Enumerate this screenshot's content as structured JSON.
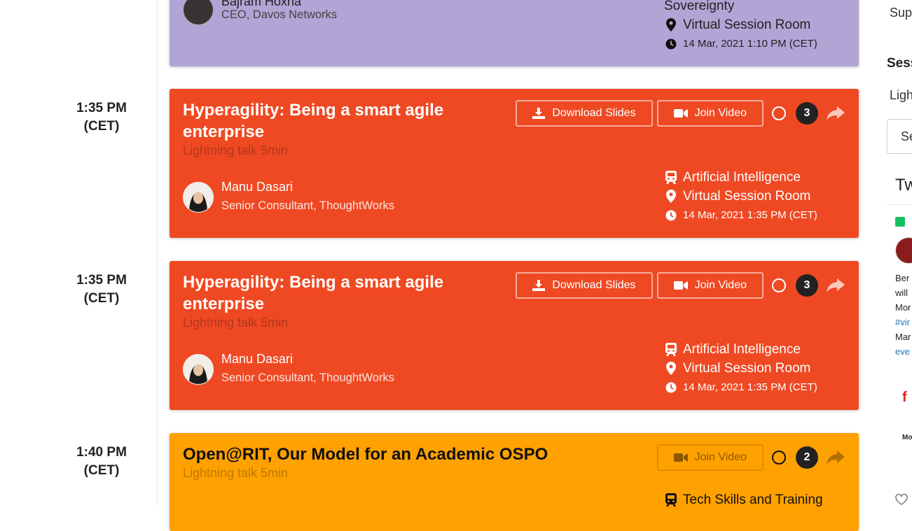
{
  "sessions": [
    {
      "time": "",
      "tz": "",
      "title": "",
      "subtitle": "",
      "speaker_name": "Bajram Hoxha",
      "speaker_role": "CEO, Davos Networks",
      "track": "Sovereignty",
      "room": "Virtual Session Room",
      "datetime": "14 Mar, 2021 1:10 PM (CET)"
    },
    {
      "time": "1:35 PM",
      "tz": "(CET)",
      "title": "Hyperagility: Being a smart agile enterprise",
      "subtitle": "Lightning talk 5min",
      "download_label": "Download Slides",
      "join_label": "Join Video",
      "count": "3",
      "speaker_name": "Manu Dasari",
      "speaker_role": "Senior Consultant, ThoughtWorks",
      "track": "Artificial Intelligence",
      "room": "Virtual Session Room",
      "datetime": "14 Mar, 2021 1:35 PM (CET)"
    },
    {
      "time": "1:35 PM",
      "tz": "(CET)",
      "title": "Hyperagility: Being a smart agile enterprise",
      "subtitle": "Lightning talk 5min",
      "download_label": "Download Slides",
      "join_label": "Join Video",
      "count": "3",
      "speaker_name": "Manu Dasari",
      "speaker_role": "Senior Consultant, ThoughtWorks",
      "track": "Artificial Intelligence",
      "room": "Virtual Session Room",
      "datetime": "14 Mar, 2021 1:35 PM (CET)"
    },
    {
      "time": "1:40 PM",
      "tz": "(CET)",
      "title": "Open@RIT, Our Model for an Academic OSPO",
      "subtitle": "Lightning talk 5min",
      "join_label": "Join Video",
      "count": "2",
      "track": "Tech Skills and Training"
    }
  ],
  "sidebar": {
    "sup": "Sup",
    "sess": "Sess",
    "ligh": "Ligh",
    "se": "Se",
    "tw": "Tw",
    "tweet_lines": [
      "Ber",
      "will",
      "Mor",
      "#vir",
      "Mar",
      "eve"
    ],
    "mo": "Mo"
  },
  "colors": {
    "purple": "#b3a4d6",
    "red": "#ef4923",
    "orange": "#ffa100"
  }
}
